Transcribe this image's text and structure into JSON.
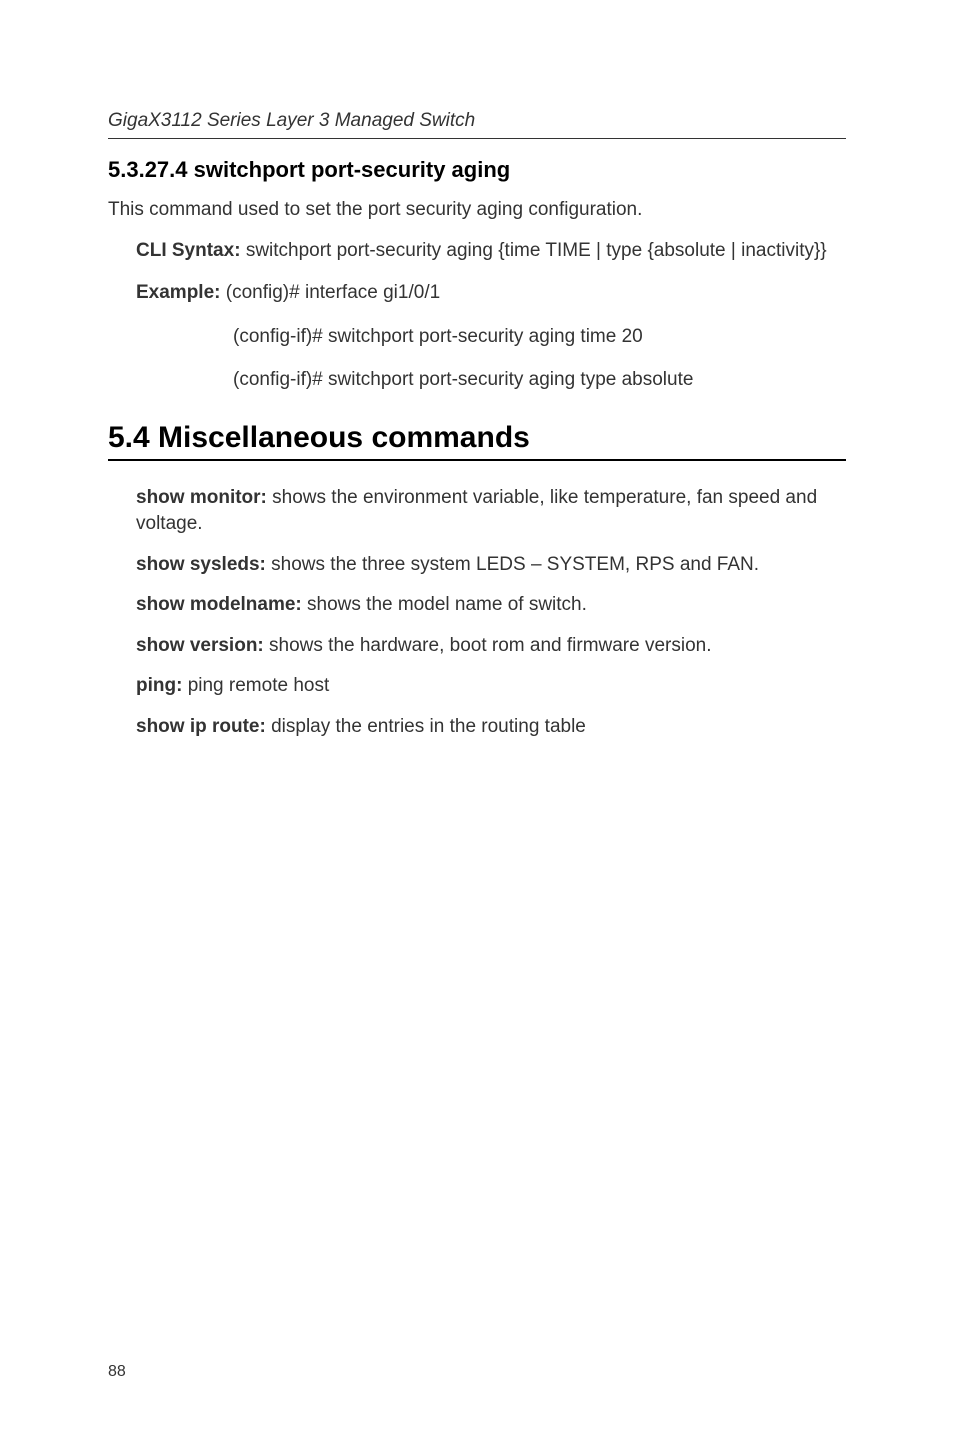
{
  "header": {
    "title": "GigaX3112 Series Layer 3 Managed Switch"
  },
  "section": {
    "heading": "5.3.27.4   switchport port-security aging",
    "intro": "This command used to set the port security aging configuration.",
    "cli_label": "CLI Syntax: ",
    "cli_text": "switchport port-security aging {time TIME | type {absolute | inactivity}}",
    "example_label": "Example:  ",
    "example_line1": "(config)#  interface gi1/0/1",
    "example_line2": "(config-if)# switchport port-security aging time 20",
    "example_line3": "(config-if)# switchport port-security aging type absolute"
  },
  "misc": {
    "heading": "5.4 Miscellaneous commands",
    "items": [
      {
        "label": "show monitor: ",
        "text": "shows the environment variable, like temperature, fan speed and voltage."
      },
      {
        "label": "show sysleds: ",
        "text": "shows the three system LEDS – SYSTEM, RPS and FAN."
      },
      {
        "label": "show modelname: ",
        "text": "shows the model name of switch."
      },
      {
        "label": "show version: ",
        "text": "shows the hardware, boot rom and firmware version."
      },
      {
        "label": "ping: ",
        "text": "ping remote host"
      },
      {
        "label": "show ip route: ",
        "text": "display the entries in the routing table"
      }
    ]
  },
  "page_num": "88"
}
